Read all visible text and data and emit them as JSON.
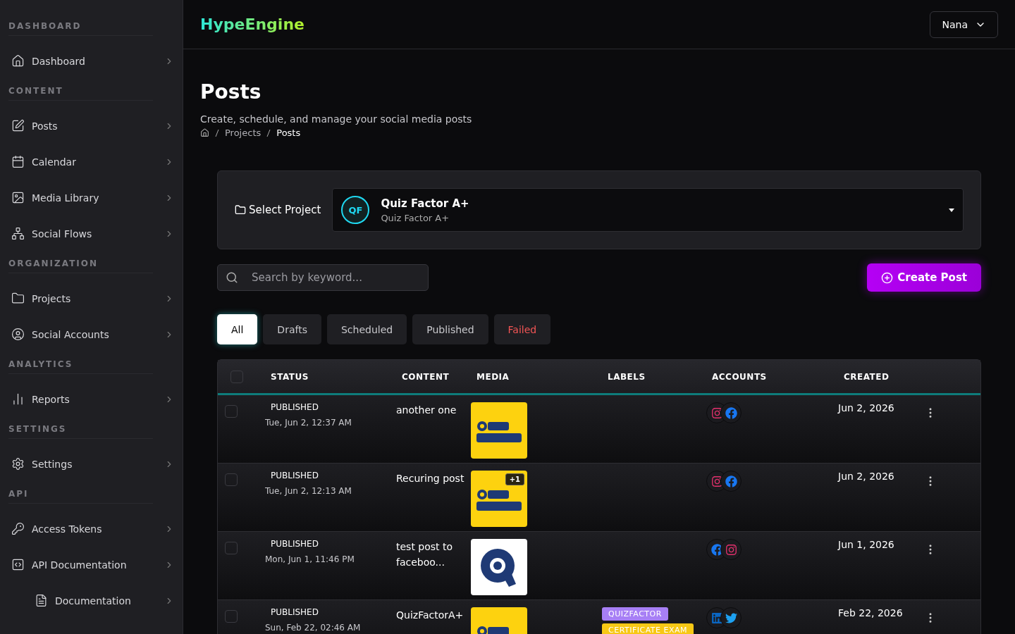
{
  "sidebar": {
    "sections": [
      {
        "heading": "DASHBOARD",
        "items": [
          {
            "label": "Dashboard"
          }
        ]
      },
      {
        "heading": "CONTENT",
        "items": [
          {
            "label": "Posts"
          },
          {
            "label": "Calendar"
          },
          {
            "label": "Media Library"
          },
          {
            "label": "Social Flows"
          }
        ]
      },
      {
        "heading": "ORGANIZATION",
        "items": [
          {
            "label": "Projects"
          },
          {
            "label": "Social Accounts"
          }
        ]
      },
      {
        "heading": "ANALYTICS",
        "items": [
          {
            "label": "Reports"
          }
        ]
      },
      {
        "heading": "SETTINGS",
        "items": [
          {
            "label": "Settings"
          }
        ]
      },
      {
        "heading": "API",
        "items": [
          {
            "label": "Access Tokens"
          },
          {
            "label": "API Documentation",
            "children": [
              {
                "label": "Documentation"
              }
            ]
          }
        ]
      }
    ]
  },
  "header": {
    "brand": "HypeEngine",
    "user": "Nana"
  },
  "page": {
    "title": "Posts",
    "subtitle": "Create, schedule, and manage your social media posts",
    "breadcrumbs": [
      "Projects",
      "Posts"
    ]
  },
  "project_picker": {
    "label": "Select Project",
    "initials": "QF",
    "name": "Quiz Factor A+",
    "description": "Quiz Factor A+"
  },
  "search": {
    "placeholder": "Search by keyword..."
  },
  "create_button": "Create Post",
  "tabs": [
    {
      "label": "All",
      "selected": true,
      "kind": "normal"
    },
    {
      "label": "Drafts",
      "selected": false,
      "kind": "normal"
    },
    {
      "label": "Scheduled",
      "selected": false,
      "kind": "normal"
    },
    {
      "label": "Published",
      "selected": false,
      "kind": "normal"
    },
    {
      "label": "Failed",
      "selected": false,
      "kind": "danger"
    }
  ],
  "table": {
    "select_all_checked": false,
    "columns": [
      "STATUS",
      "CONTENT",
      "MEDIA",
      "LABELS",
      "ACCOUNTS",
      "CREATED"
    ],
    "rows": [
      {
        "checked": false,
        "status": "PUBLISHED",
        "time": "Tue, Jun 2, 12:37 AM",
        "content": "another one",
        "media": {
          "kind": "yellow"
        },
        "labels": [],
        "accounts": [
          {
            "kind": "instagram"
          },
          {
            "kind": "facebook"
          }
        ],
        "created": "Jun 2, 2026"
      },
      {
        "checked": false,
        "status": "PUBLISHED",
        "time": "Tue, Jun 2, 12:13 AM",
        "content": "Recuring post",
        "media": {
          "kind": "yellow",
          "extra": "+1"
        },
        "labels": [],
        "accounts": [
          {
            "kind": "instagram"
          },
          {
            "kind": "facebook"
          }
        ],
        "created": "Jun 2, 2026"
      },
      {
        "checked": false,
        "status": "PUBLISHED",
        "time": "Mon, Jun 1, 11:46 PM",
        "content": "test post to faceboo...",
        "media": {
          "kind": "white"
        },
        "labels": [],
        "accounts": [
          {
            "kind": "facebook"
          },
          {
            "kind": "instagram"
          }
        ],
        "created": "Jun 1, 2026"
      },
      {
        "checked": false,
        "status": "PUBLISHED",
        "time": "Sun, Feb 22, 02:46 AM",
        "content": "QuizFactorA+",
        "media": {
          "kind": "yellow"
        },
        "labels": [
          {
            "text": "QUIZFACTOR",
            "color": "#a77ff5"
          },
          {
            "text": "CERTIFICATE EXAM",
            "color": "#f7c815"
          }
        ],
        "accounts": [
          {
            "kind": "linkedin"
          },
          {
            "kind": "twitter"
          }
        ],
        "created": "Feb 22, 2026"
      }
    ]
  }
}
